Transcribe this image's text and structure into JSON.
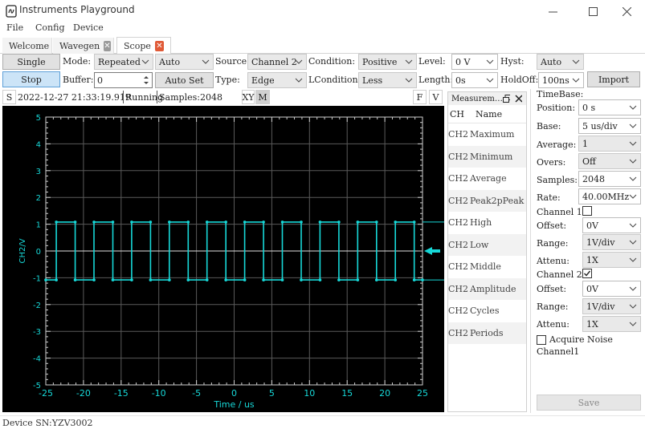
{
  "window": {
    "title": "Instruments Playground",
    "minimize": "—",
    "maximize": "☐",
    "close": "✕"
  },
  "menu": [
    "File",
    "Config",
    "Device"
  ],
  "tabs": [
    {
      "label": "Welcome"
    },
    {
      "label": "Wavegen"
    },
    {
      "label": "Scope"
    }
  ],
  "controls": {
    "single": "Single",
    "stop": "Stop",
    "mode_label": "Mode:",
    "mode_value": "Repeated",
    "mode2_value": "Auto",
    "buffer_label": "Buffer:",
    "buffer_value": "0",
    "autoset": "Auto Set",
    "source_label": "Source:",
    "source_value": "Channel 2",
    "type_label": "Type:",
    "type_value": "Edge",
    "condition_label": "Condition:",
    "condition_value": "Positive",
    "lcondition_label": "LCondition:",
    "lcondition_value": "Less",
    "level_label": "Level:",
    "level_value": "0 V",
    "length_label": "Length:",
    "length_value": "0s",
    "hyst_label": "Hyst:",
    "hyst_value": "Auto",
    "holdoff_label": "HoldOff:",
    "holdoff_value": "100ns",
    "import": "Import"
  },
  "scope_bar": {
    "s": "S",
    "timestamp": "2022-12-27 21:33:19.919",
    "state": "Running",
    "samples": "Samples:2048",
    "xy": "XY",
    "m": "M",
    "f": "F",
    "v": "V"
  },
  "chart_data": {
    "type": "line",
    "xlabel": "Time / us",
    "ylabel": "CH2/V",
    "xlim": [
      -25,
      25
    ],
    "ylim": [
      -5,
      5
    ],
    "xticks": [
      "-25",
      "-20",
      "-15",
      "-10",
      "-5",
      "0",
      "5",
      "10",
      "15",
      "20",
      "25"
    ],
    "yticks": [
      "5",
      "4",
      "3",
      "2",
      "1",
      "0",
      "-1",
      "-2",
      "-3",
      "-4",
      "-5"
    ],
    "grid": true,
    "colors": {
      "trace": "#17d8d8",
      "grid": "#5a5a5a",
      "axis": "#cfcfcf",
      "tick_label": "#17d8d8"
    },
    "series": [
      {
        "waveform": "square",
        "high": 1.08,
        "low": -1.08,
        "rising_edges": [
          -23.6,
          -18.6,
          -13.6,
          -8.6,
          -3.6,
          1.4,
          6.4,
          11.4,
          16.4,
          21.4
        ],
        "falling_edges": [
          -21.1,
          -16.1,
          -11.1,
          -6.1,
          -1.1,
          3.9,
          8.9,
          13.9,
          18.9,
          23.9
        ]
      }
    ]
  },
  "measurements": {
    "title": "Measurem…",
    "headers": {
      "ch": "CH",
      "name": "Name"
    },
    "rows": [
      {
        "ch": "CH2",
        "name": "Maximum"
      },
      {
        "ch": "CH2",
        "name": "Minimum"
      },
      {
        "ch": "CH2",
        "name": "Average"
      },
      {
        "ch": "CH2",
        "name": "Peak2pPeak"
      },
      {
        "ch": "CH2",
        "name": "High"
      },
      {
        "ch": "CH2",
        "name": "Low"
      },
      {
        "ch": "CH2",
        "name": "Middle"
      },
      {
        "ch": "CH2",
        "name": "Amplitude"
      },
      {
        "ch": "CH2",
        "name": "Cycles"
      },
      {
        "ch": "CH2",
        "name": "Periods"
      }
    ]
  },
  "timebase": {
    "title": "TimeBase:",
    "position_label": "Position:",
    "position_value": "0 s",
    "base_label": "Base:",
    "base_value": "5 us/div",
    "average_label": "Average:",
    "average_value": "1",
    "overs_label": "Overs:",
    "overs_value": "Off",
    "samples_label": "Samples:",
    "samples_value": "2048",
    "rate_label": "Rate:",
    "rate_value": "40.00MHz",
    "ch1_label": "Channel 1:",
    "ch1_checked": false,
    "ch1_offset_label": "Offset:",
    "ch1_offset_value": "0V",
    "ch1_range_label": "Range:",
    "ch1_range_value": "1V/div",
    "ch1_attenu_label": "Attenu:",
    "ch1_attenu_value": "1X",
    "ch2_label": "Channel 2:",
    "ch2_checked": true,
    "ch2_offset_label": "Offset:",
    "ch2_offset_value": "0V",
    "ch2_range_label": "Range:",
    "ch2_range_value": "1V/div",
    "ch2_attenu_label": "Attenu:",
    "ch2_attenu_value": "1X",
    "acquire_noise_label": "Acquire Noise",
    "channel1_text": "Channel1",
    "save": "Save"
  },
  "status": {
    "device_sn": "Device SN:YZV3002"
  },
  "colors": {
    "accent": "#cce4f7",
    "tab_close": "#e05a37",
    "scope_bg": "#000000"
  }
}
